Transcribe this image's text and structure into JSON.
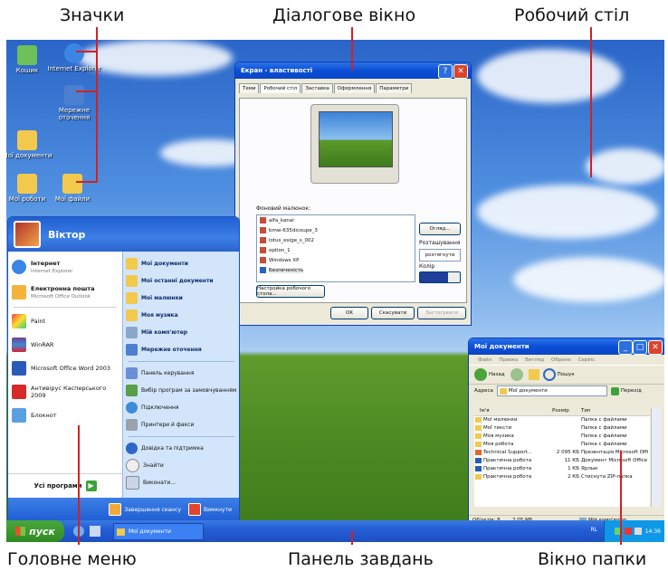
{
  "captions": {
    "icons": "Значки",
    "dialog": "Діалогове вікно",
    "desktop": "Робочий стіл",
    "start_menu": "Головне меню",
    "taskbar": "Панель завдань",
    "folder_window": "Вікно папки"
  },
  "desktop_icons": [
    "Кошик",
    "Internet Explorer",
    "Мережне оточення",
    "Мої документи",
    "Мої роботи",
    "Мої файли"
  ],
  "start_menu": {
    "user": "Віктор",
    "left_items": [
      {
        "title": "Інтернет",
        "sub": "Internet Explorer"
      },
      {
        "title": "Електронна пошта",
        "sub": "Microsoft Office Outlook"
      },
      {
        "title": "Paint",
        "sub": ""
      },
      {
        "title": "WinRAR",
        "sub": ""
      },
      {
        "title": "Microsoft Office Word 2003",
        "sub": ""
      },
      {
        "title": "Антивірус Касперського 2009",
        "sub": ""
      },
      {
        "title": "Блокнот",
        "sub": ""
      }
    ],
    "all_programs": "Усі програми",
    "right_items": [
      "Мої документи",
      "Мої останні документи",
      "Мої малюнки",
      "Моя музика",
      "Мій комп'ютер",
      "Мережне оточення",
      "Панель керування",
      "Вибір програм за замовчуванням",
      "Підключення",
      "Принтери й факси",
      "Довідка та підтримка",
      "Знайти",
      "Виконати..."
    ],
    "logoff": "Завершення сеансу",
    "shutdown": "Вимкнути"
  },
  "taskbar": {
    "start": "пуск",
    "task": "Мої документи",
    "lang": "RL",
    "clock": "14:36"
  },
  "dialog": {
    "title": "Екран - властивості",
    "tabs": [
      "Теми",
      "Робочий стіл",
      "Заставка",
      "Оформлення",
      "Параметри"
    ],
    "background_label": "Фоновий малюнок:",
    "wallpapers": [
      "alfa_kanal",
      "bmw-635dicoupe_3",
      "lotus_exige_s_002",
      "option_1",
      "Windows XP",
      "Безпеченість"
    ],
    "browse": "Огляд...",
    "position_label": "Розташування",
    "position_value": "розтягнути",
    "color_label": "Колір",
    "customize": "Настройка робочого стола...",
    "ok": "OK",
    "cancel": "Скасувати",
    "apply": "Застосувати"
  },
  "folder": {
    "title": "Мої документи",
    "menu": [
      "Файл",
      "Правка",
      "Вигляд",
      "Обране",
      "Сервіс"
    ],
    "back": "Назад",
    "search": "Пошук",
    "address_label": "Адреса",
    "address_value": "Мої документи",
    "go": "Перехід",
    "columns": [
      "Ім'я",
      "Розмір",
      "Тип"
    ],
    "rows": [
      {
        "name": "Мої малюнки",
        "size": "",
        "type": "Папка с файлами"
      },
      {
        "name": "Мої тексти",
        "size": "",
        "type": "Папка с файлами"
      },
      {
        "name": "Моя музика",
        "size": "",
        "type": "Папка с файлами"
      },
      {
        "name": "Моя робота",
        "size": "",
        "type": "Папка с файлами"
      },
      {
        "name": "Technical Support...",
        "size": "2 095 КБ",
        "type": "Презентація Microsoft Offi"
      },
      {
        "name": "Практична робота",
        "size": "11 КБ",
        "type": "Документ Microsoft Office"
      },
      {
        "name": "Практична робота",
        "size": "1 КБ",
        "type": "Ярлык"
      },
      {
        "name": "Практична робота",
        "size": "2 КБ",
        "type": "Стиснута ZIP-папка"
      }
    ],
    "status_left": "Об'єктів: 8",
    "status_size": "2,05 МБ",
    "status_right": "Мій комп'ютер"
  }
}
